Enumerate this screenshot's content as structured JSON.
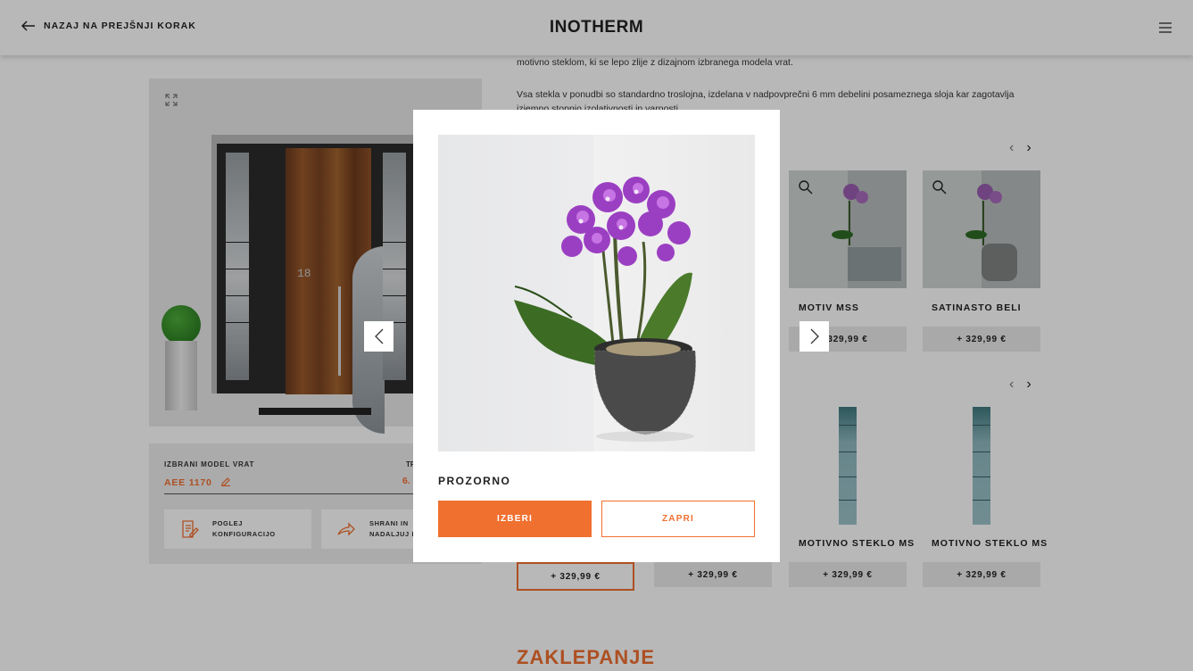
{
  "header": {
    "back_label": "NAZAJ NA PREJŠNJI KORAK",
    "logo": "INOTHERM",
    "back_icon": "arrow-left-icon",
    "menu_icon": "hamburger-menu-icon"
  },
  "intro": {
    "line1": "motivno steklom, ki se lepo zlije z dizajnom izbranega modela vrat.",
    "line2": "Vsa stekla v ponudbi so standardno troslojna, izdelana v nadpovprečni 6 mm debelini posameznega sloja kar zagotavlja",
    "line3": "izjemno stopnjo izolativnosti in varnosti."
  },
  "door_preview": {
    "house_number": "18",
    "expand_icon": "expand-icon"
  },
  "summary": {
    "model_label": "IZBRANI MODEL VRAT",
    "model_value": "AEE 1170",
    "price_label": "TR",
    "price_value": "6.",
    "view_config_label": "POGLEJ\nKONFIGURACIJO",
    "save_label": "SHRANI IN\nNADALJUJ P"
  },
  "glass_row1": [
    {
      "name": "MOTIV MSS",
      "price": "329,99 €"
    },
    {
      "name": "SATINASTO BELI",
      "price": "+ 329,99 €"
    }
  ],
  "glass_row2": {
    "prices": [
      "+ 329,99 €",
      "+ 329,99 €",
      "+ 329,99 €",
      "+ 329,99 €"
    ],
    "names": [
      "MOTIVNO STEKLO MS",
      "MOTIVNO STEKLO MS"
    ]
  },
  "section_title": "ZAKLEPANJE",
  "modal": {
    "title": "PROZORNO",
    "select_label": "IZBERI",
    "close_label": "ZAPRI"
  },
  "colors": {
    "accent": "#f07030",
    "overlay": "rgba(0,0,0,0.28)"
  }
}
